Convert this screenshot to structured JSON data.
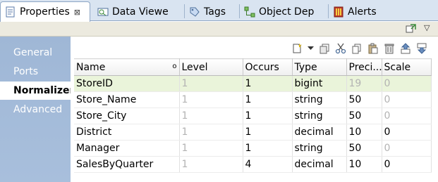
{
  "tabs": [
    {
      "label": "Properties",
      "icon": "properties-icon",
      "close": "⊠"
    },
    {
      "label": "Data Viewe",
      "icon": "data-viewer-icon"
    },
    {
      "label": "Tags",
      "icon": "tag-icon"
    },
    {
      "label": "Object Dep",
      "icon": "object-dependencies-icon"
    },
    {
      "label": "Alerts",
      "icon": "alerts-icon"
    }
  ],
  "strip": {
    "pin_icon": "pin-view-icon",
    "menu_icon": "view-menu-icon",
    "menu_glyph": "▽"
  },
  "nav": {
    "items": [
      {
        "label": "General"
      },
      {
        "label": "Ports"
      },
      {
        "label": "Normalizer"
      },
      {
        "label": "Advanced"
      }
    ]
  },
  "toolbar": {
    "icons": [
      "new-icon",
      "dropdown-arrow-icon",
      "copy-icon",
      "cut-icon",
      "copy-icon",
      "paste-icon",
      "delete-icon",
      "move-up-icon",
      "move-down-icon"
    ]
  },
  "table": {
    "headers": [
      "Name",
      "Level",
      "Occurs",
      "Type",
      "Preci...",
      "Scale"
    ],
    "sort_glyph": "o",
    "rows": [
      {
        "name": "StoreID",
        "level": "1",
        "occurs": "1",
        "type": "bigint",
        "precision": "19",
        "scale": "0"
      },
      {
        "name": "Store_Name",
        "level": "1",
        "occurs": "1",
        "type": "string",
        "precision": "50",
        "scale": "0"
      },
      {
        "name": "Store_City",
        "level": "1",
        "occurs": "1",
        "type": "string",
        "precision": "50",
        "scale": "0"
      },
      {
        "name": "District",
        "level": "1",
        "occurs": "1",
        "type": "decimal",
        "precision": "10",
        "scale": "0"
      },
      {
        "name": "Manager",
        "level": "1",
        "occurs": "1",
        "type": "string",
        "precision": "50",
        "scale": "0"
      },
      {
        "name": "SalesByQuarter",
        "level": "1",
        "occurs": "4",
        "type": "decimal",
        "precision": "10",
        "scale": "0"
      }
    ]
  },
  "colors": {
    "selected_row": "#eaf4da",
    "nav_bg": "#a3bbd8",
    "tabbar_bg": "#d9e4f1"
  }
}
